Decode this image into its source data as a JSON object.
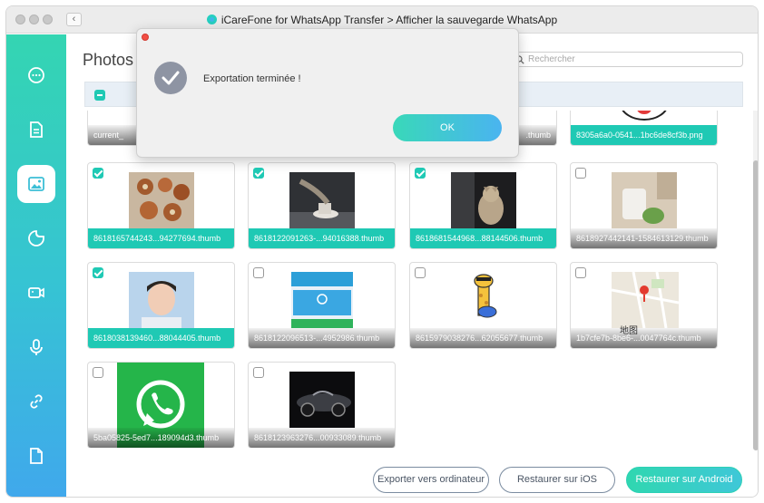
{
  "app": {
    "title": "iCareFone for WhatsApp Transfer > Afficher la sauvegarde WhatsApp",
    "back_label": "‹"
  },
  "main": {
    "page_title": "Photos",
    "search_placeholder": "Rechercher"
  },
  "sidebar": {
    "items": [
      {
        "icon": "chat-bubble-icon",
        "active": false
      },
      {
        "icon": "document-icon",
        "active": false
      },
      {
        "icon": "image-icon",
        "active": true
      },
      {
        "icon": "sticker-icon",
        "active": false
      },
      {
        "icon": "video-icon",
        "active": false
      },
      {
        "icon": "microphone-icon",
        "active": false
      },
      {
        "icon": "link-icon",
        "active": false
      },
      {
        "icon": "file-icon",
        "active": false
      }
    ]
  },
  "grid": {
    "top_row_captions": [
      "current_",
      "8305a6a0-0541...1bc6de8cf3b.png"
    ],
    "top_row_partial": ".thumb",
    "cards": [
      {
        "caption": "8618165744243...94277694.thumb",
        "checked": true
      },
      {
        "caption": "8618122091263-...94016388.thumb",
        "checked": true
      },
      {
        "caption": "8618681544968...88144506.thumb",
        "checked": true
      },
      {
        "caption": "8618927442141-1584613129.thumb",
        "checked": false
      },
      {
        "caption": "8618038139460...88044405.thumb",
        "checked": true
      },
      {
        "caption": "8618122096513-...4952986.thumb",
        "checked": false
      },
      {
        "caption": "8615979038276...62055677.thumb",
        "checked": false
      },
      {
        "caption": "1b7cfe7b-8be6-...0047764c.thumb",
        "checked": false
      },
      {
        "caption": "5ba05825-5ed7...189094d3.thumb",
        "checked": false
      },
      {
        "caption": "8618123963276...00933089.thumb",
        "checked": false
      }
    ],
    "map_label": " 地图"
  },
  "buttons": {
    "export": "Exporter vers ordinateur",
    "restore_ios": "Restaurer sur iOS",
    "restore_android": "Restaurer sur Android"
  },
  "dialog": {
    "message": "Exportation terminée !",
    "ok_label": "OK"
  },
  "colors": {
    "accent": "#1fc9b4",
    "sidebar_top": "#34d5b2",
    "sidebar_bottom": "#40a8ec",
    "whatsapp_green": "#25b54a"
  }
}
